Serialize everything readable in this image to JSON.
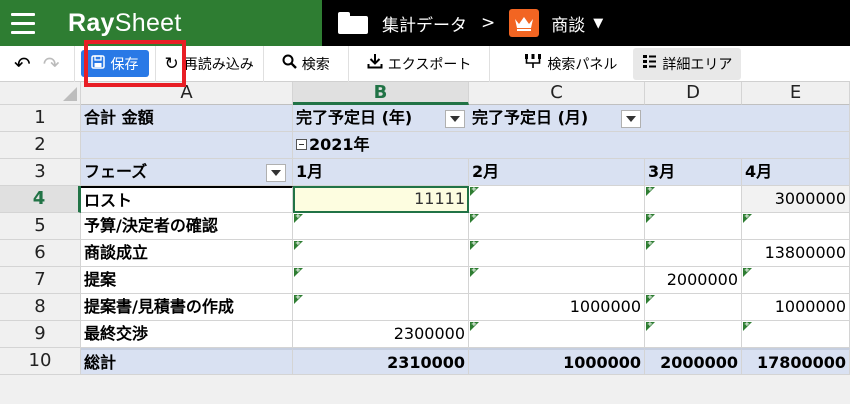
{
  "app": {
    "brand_part1": "Ray",
    "brand_part2": "Sheet",
    "dataset_name": "集計データ",
    "separator": ">",
    "app_name": "商談"
  },
  "toolbar": {
    "undo_icon": "undo-icon",
    "redo_icon": "redo-icon",
    "save_label": "保存",
    "reload_label": "再読み込み",
    "search_label": "検索",
    "export_label": "エクスポート",
    "search_panel_label": "検索パネル",
    "detail_area_label": "詳細エリア"
  },
  "colors": {
    "brand_green": "#2e7d32",
    "save_blue": "#2979e6",
    "highlight_red": "#e81e25",
    "pivot_header": "#d9e1f2"
  },
  "grid": {
    "columns": [
      "A",
      "B",
      "C",
      "D",
      "E"
    ],
    "selected_column": "B",
    "rows": [
      "1",
      "2",
      "3",
      "4",
      "5",
      "6",
      "7",
      "8",
      "9",
      "10"
    ],
    "selected_row": "4",
    "r1": {
      "a": "合計 金額",
      "b": "完了予定日 (年)",
      "c": "完了予定日 (月)"
    },
    "r2": {
      "b": "2021年"
    },
    "r3": {
      "a": "フェーズ",
      "b": "1月",
      "c": "2月",
      "d": "3月",
      "e": "4月"
    },
    "r4": {
      "a": "ロスト",
      "b": "11111",
      "e": "3000000"
    },
    "r5": {
      "a": "予算/決定者の確認"
    },
    "r6": {
      "a": "商談成立",
      "e": "13800000"
    },
    "r7": {
      "a": "提案",
      "d": "2000000"
    },
    "r8": {
      "a": "提案書/見積書の作成",
      "c": "1000000",
      "e": "1000000"
    },
    "r9": {
      "a": "最終交渉",
      "b": "2300000"
    },
    "r10": {
      "a": "総計",
      "b": "2310000",
      "c": "1000000",
      "d": "2000000",
      "e": "17800000"
    }
  }
}
